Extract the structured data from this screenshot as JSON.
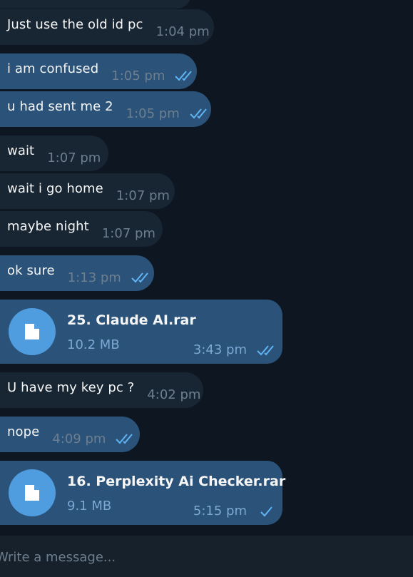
{
  "colors": {
    "background": "#0e1621",
    "incoming_bubble": "#182533",
    "outgoing_bubble": "#2b5278",
    "accent": "#4f9cdf",
    "tick": "#5fb4f5",
    "composer": "#17212b"
  },
  "messages": [
    {
      "text": "Just use the old id pc",
      "time": "1:04 pm"
    },
    {
      "text": "i am confused",
      "time": "1:05 pm",
      "status": "read"
    },
    {
      "text": "u had sent me 2",
      "time": "1:05 pm",
      "status": "read"
    },
    {
      "text": "wait",
      "time": "1:07 pm"
    },
    {
      "text": "wait i go home",
      "time": "1:07 pm"
    },
    {
      "text": "maybe night",
      "time": "1:07 pm"
    },
    {
      "text": "ok sure",
      "time": "1:13 pm",
      "status": "read"
    },
    {
      "text": "U have my key pc ?",
      "time": "4:02 pm"
    },
    {
      "text": "nope",
      "time": "4:09 pm",
      "status": "read"
    }
  ],
  "files": [
    {
      "name": "25. Claude AI.rar",
      "size": "10.2 MB",
      "time": "3:43 pm",
      "status": "read",
      "icon": "file-icon"
    },
    {
      "name": "16. Perplexity Ai Checker.rar",
      "size": "9.1 MB",
      "time": "5:15 pm",
      "status": "sent",
      "icon": "file-icon"
    }
  ],
  "composer": {
    "placeholder": "Write a message..."
  }
}
